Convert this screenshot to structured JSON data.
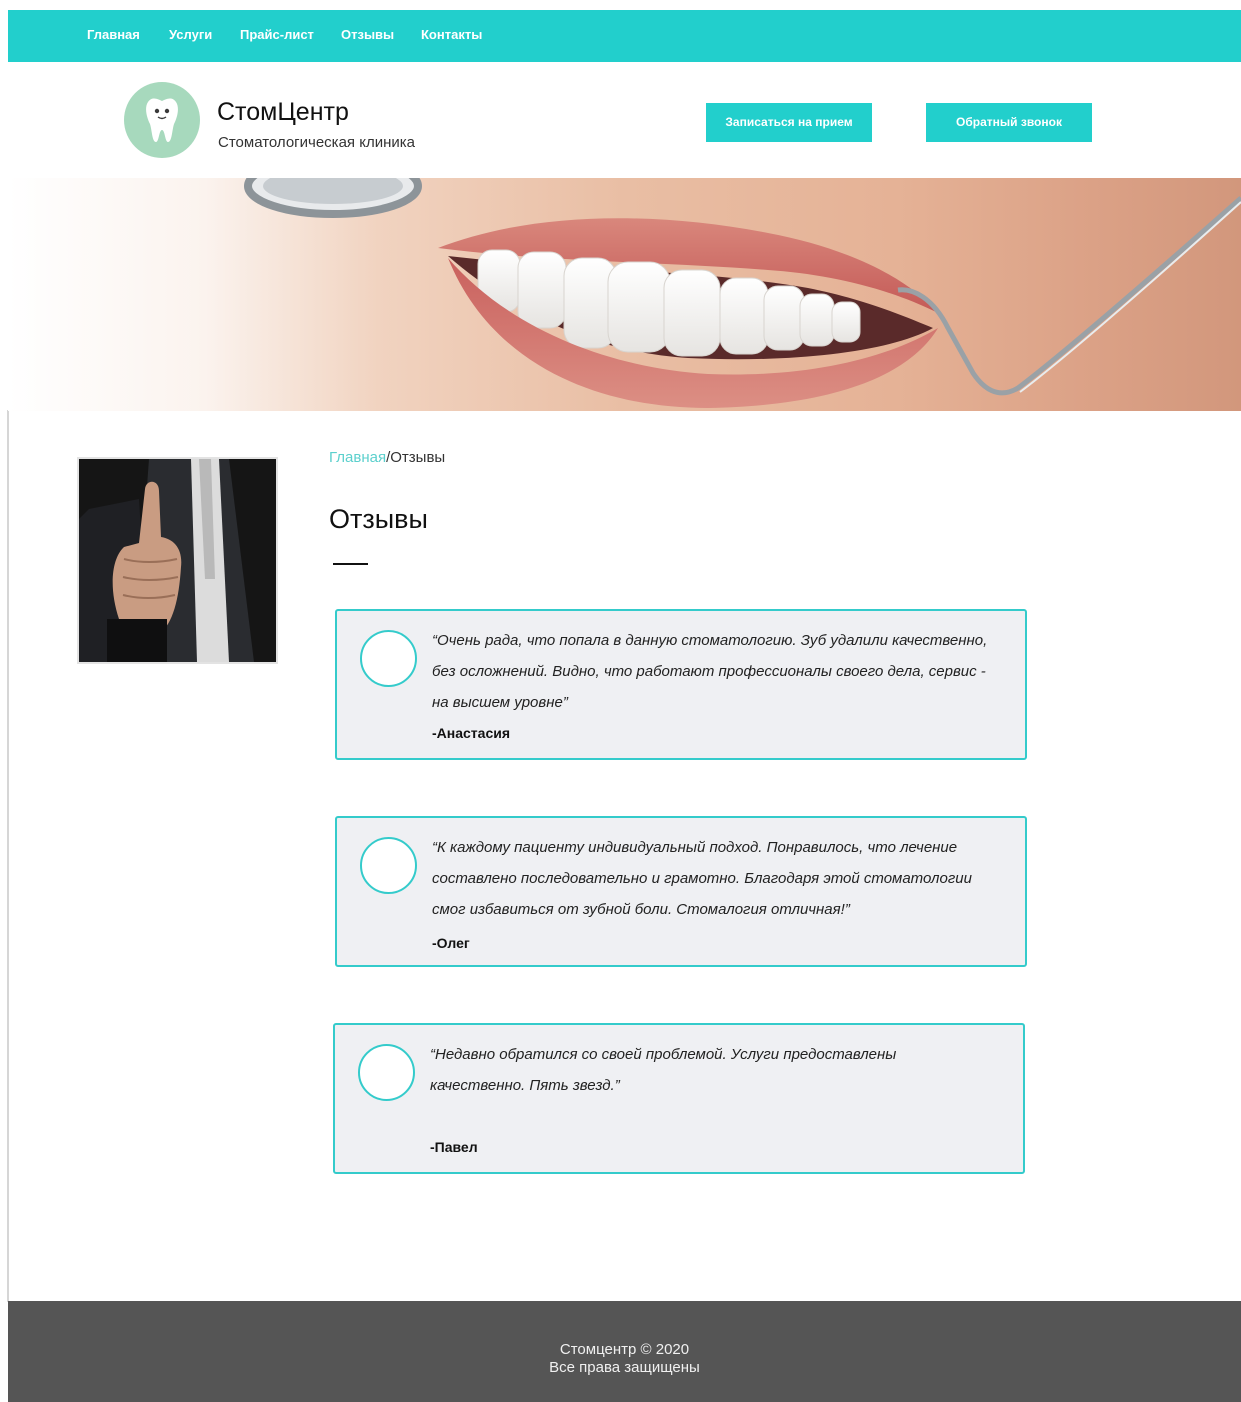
{
  "nav": {
    "items": [
      {
        "label": "Главная"
      },
      {
        "label": "Услуги"
      },
      {
        "label": "Прайс-лист"
      },
      {
        "label": "Отзывы"
      },
      {
        "label": "Контакты"
      }
    ]
  },
  "header": {
    "logo_icon": "tooth-icon",
    "title": "СтомЦентр",
    "subtitle": "Стоматологическая клиника",
    "appointment_button": "Записаться на прием",
    "callback_button": "Обратный звонок"
  },
  "breadcrumb": {
    "home": "Главная",
    "separator": "/",
    "current": "Отзывы"
  },
  "page": {
    "title": "Отзывы"
  },
  "reviews": [
    {
      "text": "“Очень рада, что попала в данную стоматологию. Зуб удалили качественно, без осложнений. Видно, что работают профессионалы своего дела, сервис - на высшем уровне”",
      "author": "-Анастасия"
    },
    {
      "text": "“К каждому пациенту индивидуальный подход. Понравилось, что лечение составлено последовательно и грамотно. Благодаря этой стоматологии смог избавиться от зубной боли. Стомалогия отличная!”",
      "author": "-Олег"
    },
    {
      "text": "“Недавно обратился со своей проблемой. Услуги предоставлены качественно. Пять звезд.”",
      "author": "-Павел"
    }
  ],
  "footer": {
    "line1": "Стомцентр © 2020",
    "line2": "Все права защищены"
  },
  "colors": {
    "accent": "#22cfcc",
    "footer_bg": "#555555",
    "card_bg": "#eff0f3",
    "card_border": "#34cbcb"
  }
}
